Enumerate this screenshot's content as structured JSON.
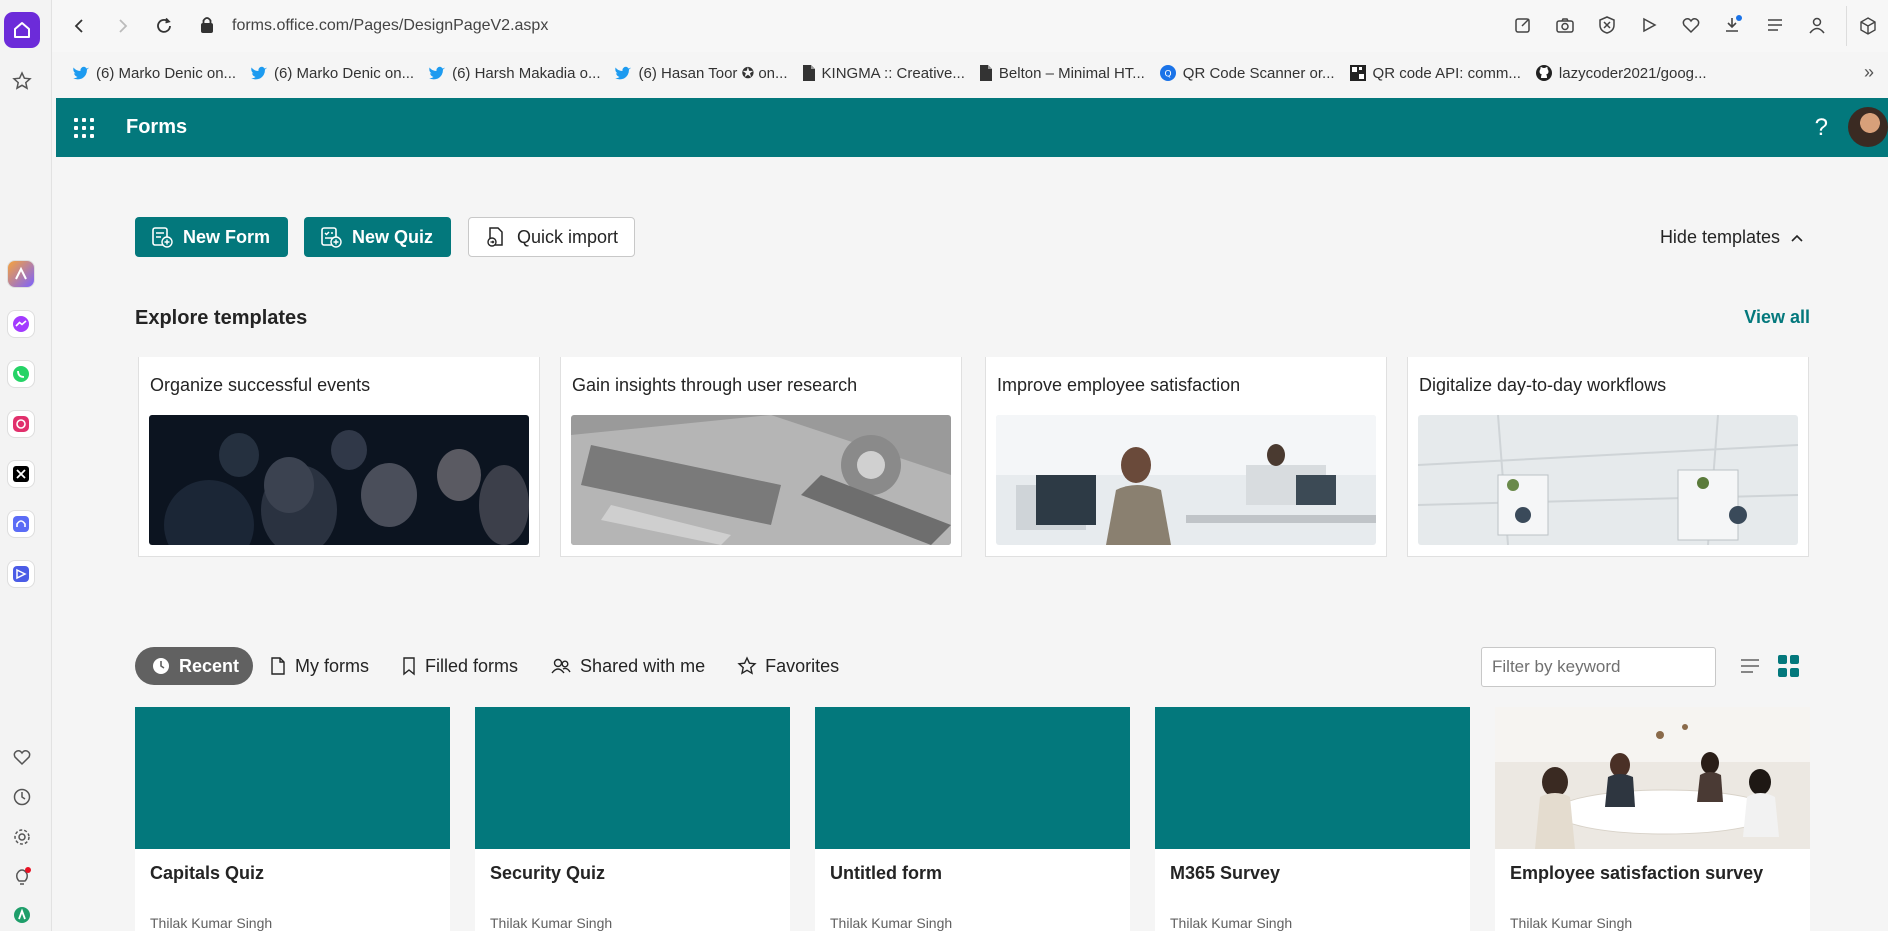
{
  "browser": {
    "url": "forms.office.com/Pages/DesignPageV2.aspx",
    "bookmarks": [
      {
        "label": "(6) Marko Denic on...",
        "icon": "twitter-icon"
      },
      {
        "label": "(6) Marko Denic on...",
        "icon": "twitter-icon"
      },
      {
        "label": "(6) Harsh Makadia o...",
        "icon": "twitter-icon"
      },
      {
        "label": "(6) Hasan Toor ✪ on...",
        "icon": "twitter-icon"
      },
      {
        "label": "KINGMA :: Creative...",
        "icon": "document-icon"
      },
      {
        "label": "Belton – Minimal HT...",
        "icon": "document-icon"
      },
      {
        "label": "QR Code Scanner or...",
        "icon": "qr-scanner-icon"
      },
      {
        "label": "QR code API: comm...",
        "icon": "qr-code-icon"
      },
      {
        "label": "lazycoder2021/goog...",
        "icon": "github-icon"
      }
    ]
  },
  "header": {
    "app_title": "Forms",
    "help": "?"
  },
  "actions": {
    "new_form": "New Form",
    "new_quiz": "New Quiz",
    "quick_import": "Quick import",
    "hide_templates": "Hide templates"
  },
  "templates": {
    "section_title": "Explore templates",
    "view_all": "View all",
    "items": [
      {
        "title": "Organize successful events"
      },
      {
        "title": "Gain insights through user research"
      },
      {
        "title": "Improve employee satisfaction"
      },
      {
        "title": "Digitalize day-to-day workflows"
      }
    ]
  },
  "tabs": [
    {
      "label": "Recent",
      "active": true
    },
    {
      "label": "My forms"
    },
    {
      "label": "Filled forms"
    },
    {
      "label": "Shared with me"
    },
    {
      "label": "Favorites"
    }
  ],
  "filter": {
    "placeholder": "Filter by keyword"
  },
  "forms": [
    {
      "title": "Capitals Quiz",
      "owner": "Thilak Kumar Singh"
    },
    {
      "title": "Security Quiz",
      "owner": "Thilak Kumar Singh"
    },
    {
      "title": "Untitled form",
      "owner": "Thilak Kumar Singh"
    },
    {
      "title": "M365 Survey",
      "owner": "Thilak Kumar Singh"
    },
    {
      "title": "Employee satisfaction survey",
      "owner": "Thilak Kumar Singh"
    }
  ],
  "colors": {
    "brand": "#03787c",
    "active_tab": "#616161",
    "browser_accent": "#6c2bd9"
  }
}
